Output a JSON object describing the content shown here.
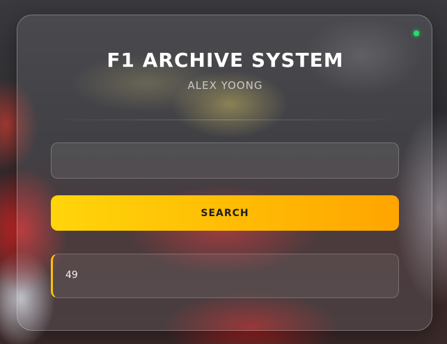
{
  "app": {
    "title": "F1 ARCHIVE SYSTEM",
    "subtitle": "ALEX YOONG"
  },
  "status": {
    "color": "#22e06a"
  },
  "search": {
    "value": "",
    "placeholder": "",
    "button_label": "SEARCH"
  },
  "result": {
    "value": "49"
  },
  "colors": {
    "accent_start": "#ffd50a",
    "accent_end": "#ffa500",
    "result_border": "#ffc107"
  }
}
